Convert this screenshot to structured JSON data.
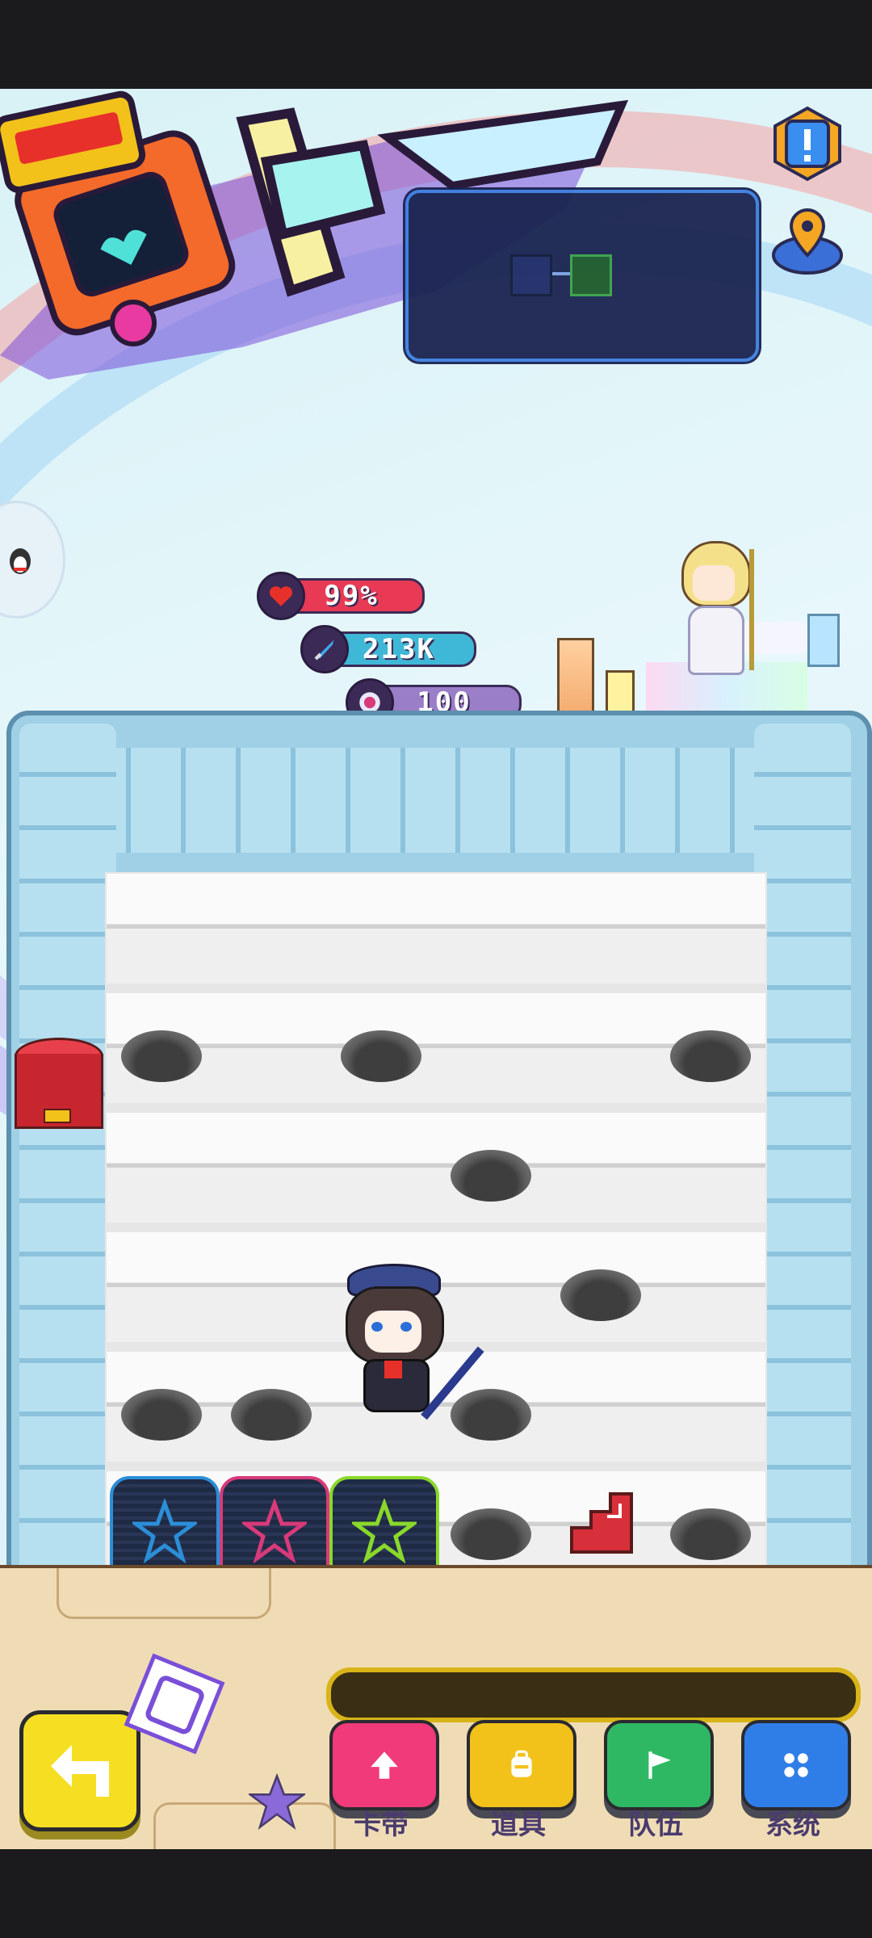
{
  "stats": {
    "hp": "99%",
    "attack": "213K",
    "gems": "100"
  },
  "menu": {
    "cassette": "卡带",
    "items": "道具",
    "team": "队伍",
    "system": "系统"
  },
  "colors": {
    "hp_bar": "#e83a55",
    "attack_bar": "#3fb7d6",
    "gem_bar": "#9a7ec8",
    "btn_cassette": "#f03a7a",
    "btn_items": "#f2c21a",
    "btn_team": "#2fb864",
    "btn_system": "#2f7ee8",
    "back_button": "#f6df22",
    "minimap_room_current": "#1d5a2a",
    "minimap_room": "#1e2a66"
  },
  "icons": {
    "quest": "exclamation-badge-icon",
    "map": "map-pin-icon",
    "back": "return-arrow-icon",
    "cassette": "up-arrow-icon",
    "items": "backpack-icon",
    "team": "flag-icon",
    "system": "four-dots-icon",
    "hp": "heart-icon",
    "attack": "sword-icon",
    "gems": "gem-icon"
  },
  "board": {
    "holes": [
      [
        1,
        0
      ],
      [
        1,
        2
      ],
      [
        1,
        5
      ],
      [
        2,
        3
      ],
      [
        3,
        4
      ],
      [
        4,
        0
      ],
      [
        4,
        1
      ],
      [
        4,
        3
      ],
      [
        5,
        3
      ],
      [
        5,
        5
      ]
    ],
    "star_slots": [
      "#2b8ed8",
      "#d83a7a",
      "#8ad82b"
    ]
  }
}
